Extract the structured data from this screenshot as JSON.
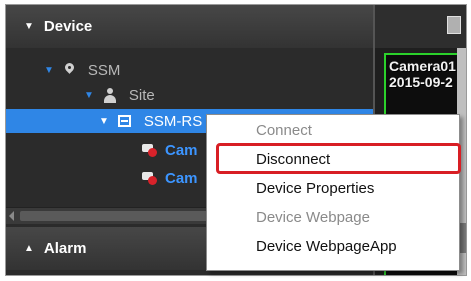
{
  "device_panel": {
    "header": "Device",
    "tree": {
      "ssm": "SSM",
      "site": "Site",
      "ssm_rs": "SSM-RS",
      "camera_1": "Cam",
      "camera_2": "Cam"
    }
  },
  "alarm_panel": {
    "header": "Alarm"
  },
  "camera_view": {
    "overlay_line1": "Camera01",
    "overlay_line2": "2015-09-2"
  },
  "context_menu": {
    "items": [
      {
        "label": "Connect",
        "enabled": false
      },
      {
        "label": "Disconnect",
        "enabled": true,
        "highlighted": true
      },
      {
        "label": "Device Properties",
        "enabled": true
      },
      {
        "label": "Device Webpage",
        "enabled": false
      },
      {
        "label": "Device WebpageApp",
        "enabled": true
      }
    ]
  },
  "colors": {
    "selection": "#2f86e6",
    "camera_text": "#3c95ff",
    "highlight_border": "#d81e24",
    "video_border": "#2bd12b"
  },
  "icons": [
    "expand-triangle-icon",
    "collapse-triangle-icon",
    "location-pin-icon",
    "user-icon",
    "server-icon",
    "camera-disconnected-icon"
  ]
}
